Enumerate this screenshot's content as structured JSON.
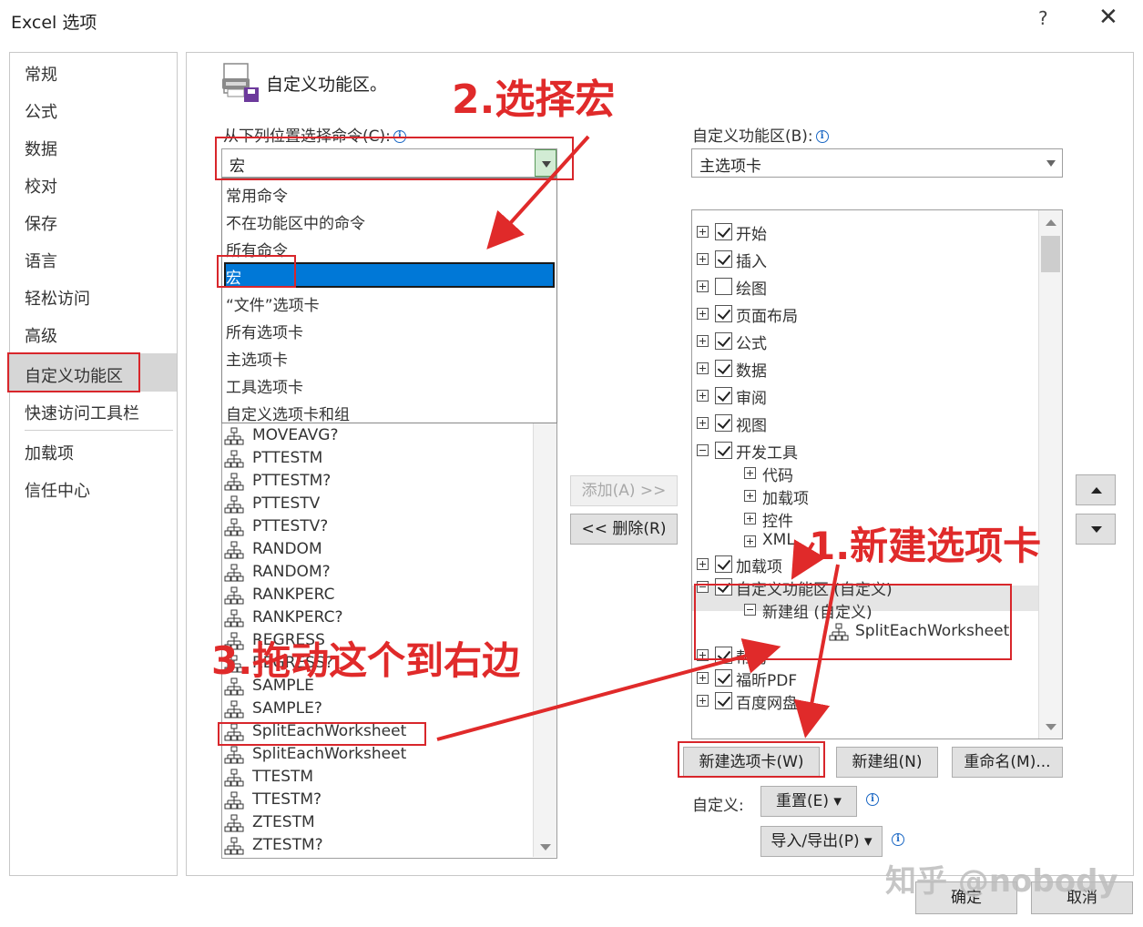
{
  "window": {
    "title": "Excel 选项",
    "help": "?",
    "close": "✕"
  },
  "nav": {
    "items": [
      "常规",
      "公式",
      "数据",
      "校对",
      "保存",
      "语言",
      "轻松访问",
      "高级",
      "自定义功能区",
      "快速访问工具栏",
      "加载项",
      "信任中心"
    ],
    "selected": "自定义功能区"
  },
  "header": {
    "text": "自定义功能区。"
  },
  "left_panel": {
    "label": "从下列位置选择命令(C):",
    "combo_value": "宏",
    "dropdown_options": [
      "常用命令",
      "不在功能区中的命令",
      "所有命令",
      "宏",
      "“文件”选项卡",
      "所有选项卡",
      "主选项卡",
      "工具选项卡",
      "自定义选项卡和组"
    ],
    "selected_option": "宏",
    "commands": [
      "MOVEAVG?",
      "PTTESTM",
      "PTTESTM?",
      "PTTESTV",
      "PTTESTV?",
      "RANDOM",
      "RANDOM?",
      "RANKPERC",
      "RANKPERC?",
      "REGRESS",
      "REGRESS?",
      "SAMPLE",
      "SAMPLE?",
      "SplitEachWorksheet",
      "SplitEachWorksheet",
      "TTESTM",
      "TTESTM?",
      "ZTESTM",
      "ZTESTM?"
    ]
  },
  "middle": {
    "add_label": "添加(A) >>",
    "remove_label": "<< 删除(R)"
  },
  "right_panel": {
    "label": "自定义功能区(B):",
    "combo_value": "主选项卡",
    "tree": [
      {
        "label": "开始",
        "checked": true,
        "expander": "plus",
        "indent": 0
      },
      {
        "label": "插入",
        "checked": true,
        "expander": "plus",
        "indent": 0
      },
      {
        "label": "绘图",
        "checked": false,
        "expander": "plus",
        "indent": 0
      },
      {
        "label": "页面布局",
        "checked": true,
        "expander": "plus",
        "indent": 0
      },
      {
        "label": "公式",
        "checked": true,
        "expander": "plus",
        "indent": 0
      },
      {
        "label": "数据",
        "checked": true,
        "expander": "plus",
        "indent": 0
      },
      {
        "label": "审阅",
        "checked": true,
        "expander": "plus",
        "indent": 0
      },
      {
        "label": "视图",
        "checked": true,
        "expander": "plus",
        "indent": 0
      },
      {
        "label": "开发工具",
        "checked": true,
        "expander": "minus",
        "indent": 0
      },
      {
        "label": "代码",
        "checked": null,
        "expander": "plus",
        "indent": 1
      },
      {
        "label": "加载项",
        "checked": null,
        "expander": "plus",
        "indent": 1
      },
      {
        "label": "控件",
        "checked": null,
        "expander": "plus",
        "indent": 1
      },
      {
        "label": "XML",
        "checked": null,
        "expander": "plus",
        "indent": 1
      },
      {
        "label": "加载项",
        "checked": true,
        "expander": "plus",
        "indent": 0
      },
      {
        "label": "自定义功能区 (自定义)",
        "checked": true,
        "expander": "minus",
        "indent": 0
      },
      {
        "label": "新建组 (自定义)",
        "checked": null,
        "expander": "minus",
        "indent": 1
      },
      {
        "label": "SplitEachWorksheet",
        "checked": null,
        "expander": "none",
        "indent": 2
      },
      {
        "label": "帮助",
        "checked": true,
        "expander": "plus",
        "indent": 0
      },
      {
        "label": "福昕PDF",
        "checked": true,
        "expander": "plus",
        "indent": 0
      },
      {
        "label": "百度网盘",
        "checked": true,
        "expander": "plus",
        "indent": 0
      }
    ],
    "new_tab_label": "新建选项卡(W)",
    "new_group_label": "新建组(N)",
    "rename_label": "重命名(M)...",
    "customize_label": "自定义:",
    "reset_label": "重置(E) ▾",
    "import_export_label": "导入/导出(P) ▾"
  },
  "footer": {
    "ok_label": "确定",
    "cancel_label": "取消"
  },
  "annotations": {
    "step1": "1.新建选项卡",
    "step2": "2.选择宏",
    "step3": "3.拖动这个到右边",
    "color": "#e02a2a"
  },
  "watermark": "知乎 @nobody"
}
